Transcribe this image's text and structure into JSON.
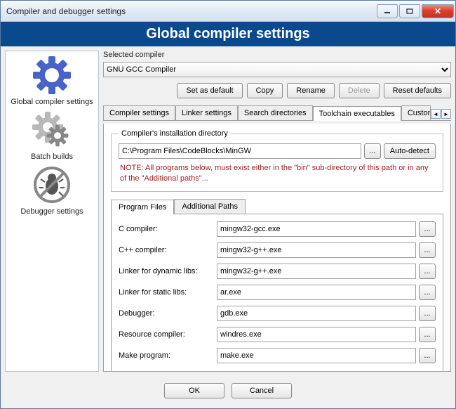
{
  "window": {
    "title": "Compiler and debugger settings",
    "banner": "Global compiler settings"
  },
  "sidebar": {
    "items": [
      {
        "label": "Global compiler settings"
      },
      {
        "label": "Batch builds"
      },
      {
        "label": "Debugger settings"
      }
    ]
  },
  "selected": {
    "label": "Selected compiler",
    "value": "GNU GCC Compiler",
    "buttons": {
      "set_default": "Set as default",
      "copy": "Copy",
      "rename": "Rename",
      "delete": "Delete",
      "reset": "Reset defaults"
    }
  },
  "tabs": {
    "items": [
      "Compiler settings",
      "Linker settings",
      "Search directories",
      "Toolchain executables",
      "Custom va"
    ],
    "active_index": 3
  },
  "toolchain": {
    "dir_legend": "Compiler's installation directory",
    "dir_value": "C:\\Program Files\\CodeBlocks\\MinGW",
    "browse": "...",
    "auto": "Auto-detect",
    "note": "NOTE: All programs below, must exist either in the \"bin\" sub-directory of this path or in any of the \"Additional paths\"...",
    "inner_tabs": [
      "Program Files",
      "Additional Paths"
    ],
    "programs": [
      {
        "label": "C compiler:",
        "value": "mingw32-gcc.exe"
      },
      {
        "label": "C++ compiler:",
        "value": "mingw32-g++.exe"
      },
      {
        "label": "Linker for dynamic libs:",
        "value": "mingw32-g++.exe"
      },
      {
        "label": "Linker for static libs:",
        "value": "ar.exe"
      },
      {
        "label": "Debugger:",
        "value": "gdb.exe"
      },
      {
        "label": "Resource compiler:",
        "value": "windres.exe"
      },
      {
        "label": "Make program:",
        "value": "make.exe"
      }
    ]
  },
  "footer": {
    "ok": "OK",
    "cancel": "Cancel"
  }
}
